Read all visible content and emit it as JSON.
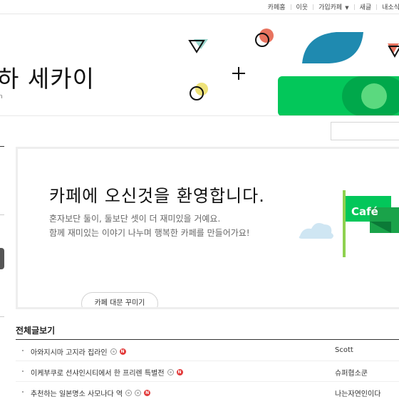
{
  "topbar": {
    "links": [
      "카페홈",
      "이웃",
      "가입카페",
      "새글",
      "내소식"
    ]
  },
  "header": {
    "cafe_name": "하 세카이",
    "cafe_url": "n"
  },
  "welcome": {
    "heading": "카페에 오신것을 환영합니다.",
    "desc_line1": "혼자보단 둘이, 둘보단 셋이 더 재미있을 거예요.",
    "desc_line2": "함께 재미있는 이야기 나누며 행복한 카페를 만들어가요!",
    "decorate_button": "카페 대문 꾸미기",
    "flag_text": "Café"
  },
  "board": {
    "title": "전체글보기",
    "rows": [
      {
        "title": "아와지시마 고지라 집라인",
        "author": "Scott"
      },
      {
        "title": "이케부쿠로 선샤인시티에서 한 프리렌 특별전",
        "author": "슈퍼협소쿤"
      },
      {
        "title": "추천하는 일본명소 사모나다 역",
        "author": "나는자연인이다"
      }
    ]
  },
  "colors": {
    "brand_green": "#03c75a",
    "accent_teal": "#1f8ab0",
    "accent_red": "#e23a3a"
  }
}
